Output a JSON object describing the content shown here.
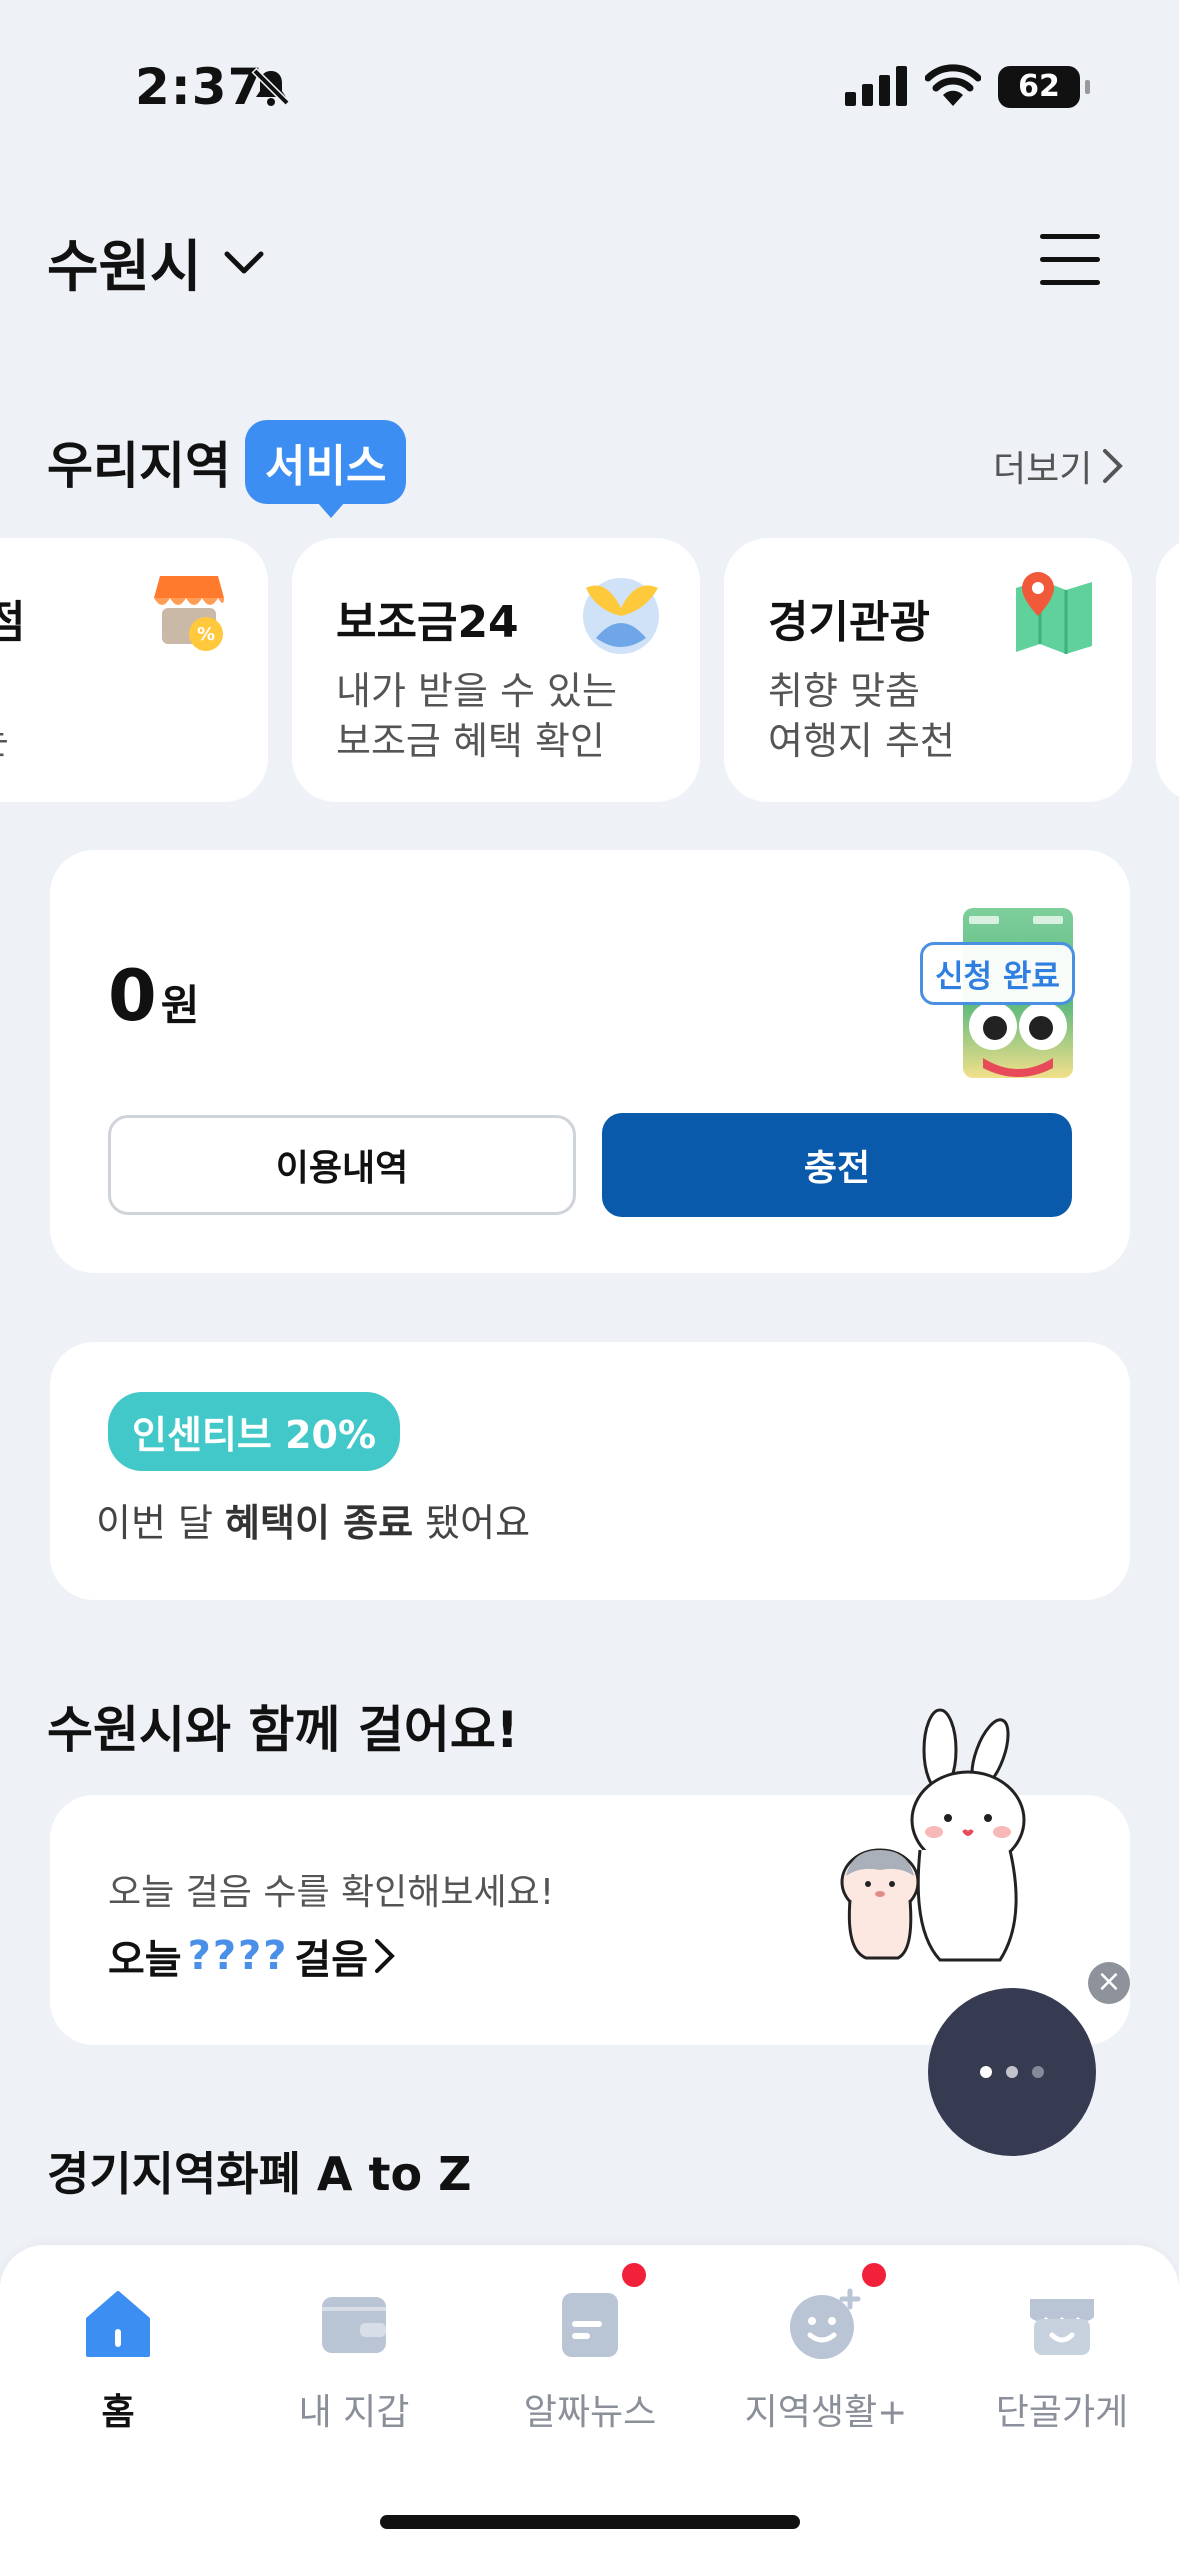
{
  "status_bar": {
    "time": "2:37",
    "battery": "62"
  },
  "header": {
    "city": "수원시"
  },
  "services": {
    "title": "우리지역",
    "badge": "서비스",
    "more": "더보기",
    "cards": [
      {
        "title": "가맹점",
        "desc": "지역\n살리는",
        "icon": "store-awning-icon"
      },
      {
        "title": "보조금24",
        "desc": "내가 받을 수 있는\n보조금 혜택 확인",
        "icon": "subsidy-bird-icon"
      },
      {
        "title": "경기관광",
        "desc": "취향 맞춤\n여행지 추천",
        "icon": "map-pin-icon"
      }
    ]
  },
  "balance": {
    "amount": "0",
    "unit": "원",
    "card_badge": "신청 완료",
    "history_label": "이용내역",
    "charge_label": "충전"
  },
  "incentive": {
    "badge": "인센티브 20%",
    "text_pre": "이번 달 ",
    "text_bold": "혜택이 종료",
    "text_post": " 됐어요"
  },
  "walk": {
    "title": "수원시와 함께 걸어요!",
    "subtitle": "오늘 걸음 수를 확인해보세요!",
    "today": "오늘",
    "steps": "????",
    "unit": "걸음"
  },
  "az": {
    "title": "경기지역화폐 A to Z"
  },
  "nav": [
    {
      "label": "홈",
      "icon": "home-icon",
      "active": true
    },
    {
      "label": "내 지갑",
      "icon": "wallet-icon"
    },
    {
      "label": "알짜뉴스",
      "icon": "news-icon",
      "badge": true
    },
    {
      "label": "지역생활+",
      "icon": "smile-icon",
      "badge": true
    },
    {
      "label": "단골가게",
      "icon": "shop-icon"
    }
  ],
  "colors": {
    "accent": "#3d8ef2",
    "primary_button": "#0a5aac",
    "incentive": "#43c8c9",
    "badge_dot": "#f1213a"
  }
}
